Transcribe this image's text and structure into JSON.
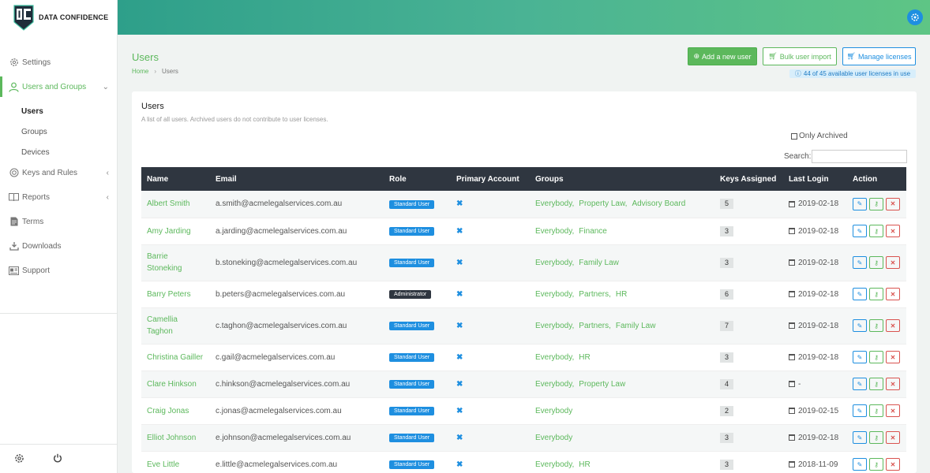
{
  "brand": {
    "name": "DATA CONFIDENCE"
  },
  "sidebar": {
    "items": [
      {
        "label": "Settings",
        "icon": "gear-icon"
      },
      {
        "label": "Users and Groups",
        "icon": "user-icon"
      },
      {
        "label": "Keys and Rules",
        "icon": "target-icon"
      },
      {
        "label": "Reports",
        "icon": "book-icon"
      },
      {
        "label": "Terms",
        "icon": "document-icon"
      },
      {
        "label": "Downloads",
        "icon": "download-icon"
      },
      {
        "label": "Support",
        "icon": "id-card-icon"
      }
    ],
    "sub_items": [
      {
        "label": "Users"
      },
      {
        "label": "Groups"
      },
      {
        "label": "Devices"
      }
    ]
  },
  "page": {
    "title": "Users",
    "breadcrumb": {
      "home": "Home",
      "current": "Users"
    }
  },
  "actions": {
    "add_label": "Add a new user",
    "bulk_label": "Bulk user import",
    "manage_label": "Manage licenses",
    "license_info": "44 of 45 available user licenses in use"
  },
  "card": {
    "title": "Users",
    "subtitle": "A list of all users. Archived users do not contribute to user licenses.",
    "archived_label": "Only Archived",
    "search_label": "Search:"
  },
  "table": {
    "headers": [
      "Name",
      "Email",
      "Role",
      "Primary Account",
      "Groups",
      "Keys Assigned",
      "Last Login",
      "Action"
    ],
    "rows": [
      {
        "name": "Albert Smith",
        "email": "a.smith@acmelegalservices.com.au",
        "role": "Standard User",
        "groups": [
          "Everybody",
          "Property Law",
          "Advisory Board"
        ],
        "keys": "5",
        "login": "2019-02-18"
      },
      {
        "name": "Amy Jarding",
        "email": "a.jarding@acmelegalservices.com.au",
        "role": "Standard User",
        "groups": [
          "Everybody",
          "Finance"
        ],
        "keys": "3",
        "login": "2019-02-18"
      },
      {
        "name": "Barrie Stoneking",
        "email": "b.stoneking@acmelegalservices.com.au",
        "role": "Standard User",
        "groups": [
          "Everybody",
          "Family Law"
        ],
        "keys": "3",
        "login": "2019-02-18"
      },
      {
        "name": "Barry Peters",
        "email": "b.peters@acmelegalservices.com.au",
        "role": "Administrator",
        "groups": [
          "Everybody",
          "Partners",
          "HR"
        ],
        "keys": "6",
        "login": "2019-02-18"
      },
      {
        "name": "Camellia Taghon",
        "email": "c.taghon@acmelegalservices.com.au",
        "role": "Standard User",
        "groups": [
          "Everybody",
          "Partners",
          "Family Law"
        ],
        "keys": "7",
        "login": "2019-02-18"
      },
      {
        "name": "Christina Gailler",
        "email": "c.gail@acmelegalservices.com.au",
        "role": "Standard User",
        "groups": [
          "Everybody",
          "HR"
        ],
        "keys": "3",
        "login": "2019-02-18"
      },
      {
        "name": "Clare Hinkson",
        "email": "c.hinkson@acmelegalservices.com.au",
        "role": "Standard User",
        "groups": [
          "Everybody",
          "Property Law"
        ],
        "keys": "4",
        "login": "-"
      },
      {
        "name": "Craig Jonas",
        "email": "c.jonas@acmelegalservices.com.au",
        "role": "Standard User",
        "groups": [
          "Everybody"
        ],
        "keys": "2",
        "login": "2019-02-15"
      },
      {
        "name": "Elliot Johnson",
        "email": "e.johnson@acmelegalservices.com.au",
        "role": "Standard User",
        "groups": [
          "Everybody"
        ],
        "keys": "3",
        "login": "2019-02-18"
      },
      {
        "name": "Eve Little",
        "email": "e.little@acmelegalservices.com.au",
        "role": "Standard User",
        "groups": [
          "Everybody",
          "HR"
        ],
        "keys": "3",
        "login": "2018-11-09"
      }
    ]
  },
  "colors": {
    "brand_green": "#5cb85c",
    "accent_blue": "#1e8fe0",
    "danger_red": "#d9534f",
    "table_header": "#2f3640"
  }
}
